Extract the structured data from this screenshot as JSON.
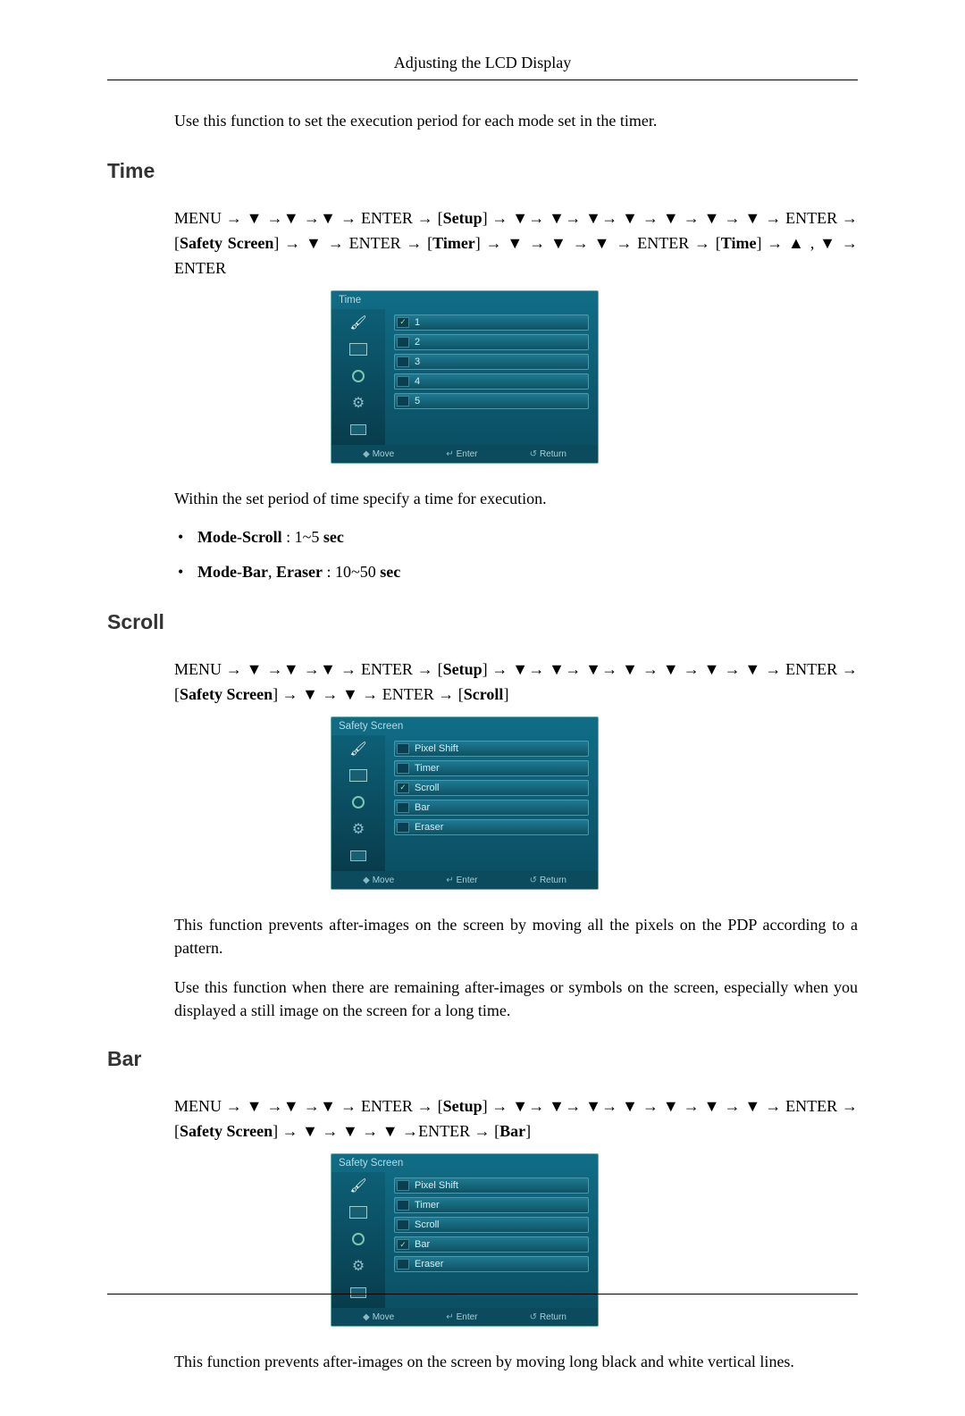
{
  "header": {
    "title": "Adjusting the LCD Display"
  },
  "intro": "Use this function to set the execution period for each mode set in the timer.",
  "symbols": {
    "down": "▼",
    "up": "▲",
    "arrow": "→"
  },
  "sections": {
    "time": {
      "heading": "Time",
      "nav_prefix": "MENU → ▼ →▼ →▼ → ENTER → [",
      "nav_setup": "Setup",
      "nav_mid1": "] → ▼→ ▼→ ▼→ ▼ → ▼ → ▼ → ▼ → ENTER → [",
      "nav_safety": "Safety Screen",
      "nav_mid2": "] → ▼ → ENTER → [",
      "nav_timer": "Timer",
      "nav_mid3": "] → ▼ → ▼ → ▼ → ENTER → [",
      "nav_time": "Time",
      "nav_suffix": "] → ▲ , ▼ → ENTER",
      "osd": {
        "title": "Time",
        "rows": [
          {
            "label": "1",
            "checked": true
          },
          {
            "label": "2",
            "checked": false
          },
          {
            "label": "3",
            "checked": false
          },
          {
            "label": "4",
            "checked": false
          },
          {
            "label": "5",
            "checked": false
          }
        ],
        "footer": {
          "move": "Move",
          "enter": "Enter",
          "return": "Return"
        }
      },
      "desc": "Within the set period of time specify a time for execution.",
      "bullets": [
        {
          "label_b1": "Mode",
          "sep1": "-",
          "label_b2": "Scroll",
          "rest": " : 1~5 ",
          "unit": "sec"
        },
        {
          "label_b1": "Mode",
          "sep1": "-",
          "label_b2": "Bar",
          "sep2": ", ",
          "label_b3": "Eraser",
          "rest": " : 10~50 ",
          "unit": "sec"
        }
      ]
    },
    "scroll": {
      "heading": "Scroll",
      "nav_prefix": "MENU → ▼ →▼ →▼ → ENTER → [",
      "nav_setup": "Setup",
      "nav_mid1": "] → ▼→ ▼→ ▼→ ▼ → ▼ → ▼ → ▼ → ENTER → [",
      "nav_safety": "Safety Screen",
      "nav_mid2": "] → ▼ → ▼ → ENTER → [",
      "nav_target": "Scroll",
      "nav_suffix": "]",
      "osd": {
        "title": "Safety Screen",
        "rows": [
          {
            "label": "Pixel Shift",
            "checked": false
          },
          {
            "label": "Timer",
            "checked": false
          },
          {
            "label": "Scroll",
            "checked": true
          },
          {
            "label": "Bar",
            "checked": false
          },
          {
            "label": "Eraser",
            "checked": false
          }
        ],
        "footer": {
          "move": "Move",
          "enter": "Enter",
          "return": "Return"
        }
      },
      "para1": "This function prevents after-images on the screen by moving all the pixels on the PDP according to a pattern.",
      "para2": "Use this function when there are remaining after-images or symbols on the screen, especially when you displayed a still image on the screen for a long time."
    },
    "bar": {
      "heading": "Bar",
      "nav_prefix": "MENU → ▼ →▼ →▼ → ENTER → [",
      "nav_setup": "Setup",
      "nav_mid1": "] → ▼→ ▼→ ▼→ ▼ → ▼ → ▼ → ▼ → ENTER → [",
      "nav_safety": "Safety Screen",
      "nav_mid2": "] → ▼ → ▼ → ▼ →ENTER → [",
      "nav_target": "Bar",
      "nav_suffix": "]",
      "osd": {
        "title": "Safety Screen",
        "rows": [
          {
            "label": "Pixel Shift",
            "checked": false
          },
          {
            "label": "Timer",
            "checked": false
          },
          {
            "label": "Scroll",
            "checked": false
          },
          {
            "label": "Bar",
            "checked": true
          },
          {
            "label": "Eraser",
            "checked": false
          }
        ],
        "footer": {
          "move": "Move",
          "enter": "Enter",
          "return": "Return"
        }
      },
      "para1": "This function prevents after-images on the screen by moving long black and white vertical lines."
    }
  }
}
